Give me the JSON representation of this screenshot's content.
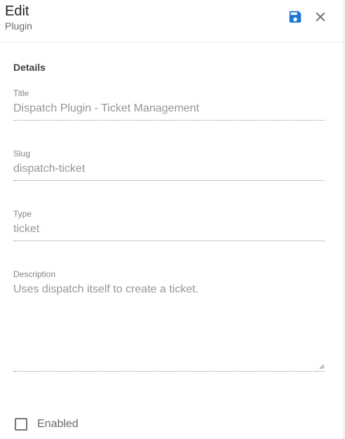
{
  "header": {
    "title": "Edit",
    "subtitle": "Plugin",
    "save_icon": "content-save-icon",
    "close_icon": "close-icon",
    "accent_color": "#1976d2"
  },
  "form": {
    "section_title": "Details",
    "title": {
      "label": "Title",
      "value": "Dispatch Plugin - Ticket Management"
    },
    "slug": {
      "label": "Slug",
      "value": "dispatch-ticket"
    },
    "type": {
      "label": "Type",
      "value": "ticket"
    },
    "description": {
      "label": "Description",
      "value": "Uses dispatch itself to create a ticket."
    },
    "enabled": {
      "label": "Enabled",
      "checked": false
    }
  }
}
